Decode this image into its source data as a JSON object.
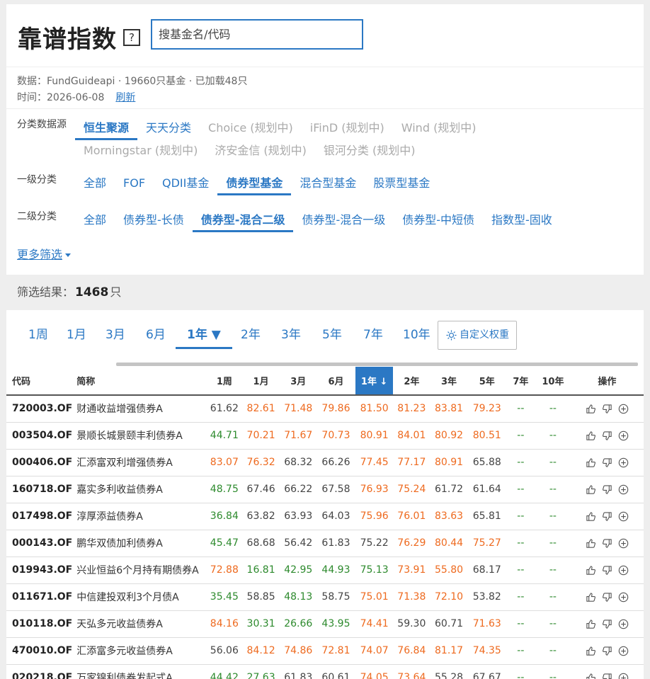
{
  "app": {
    "title": "靠谱指数",
    "help_icon": "help-icon",
    "search_placeholder": "搜基金名/代码"
  },
  "meta": {
    "line1": "数据：FundGuideapi · 19660只基金 · 已加载48只",
    "line2_label": "时间：2026-06-08",
    "refresh_label": "刷新"
  },
  "filters": {
    "source": {
      "label": "分类数据源",
      "items": [
        {
          "label": "恒生聚源",
          "state": "active"
        },
        {
          "label": "天天分类",
          "state": "normal"
        },
        {
          "label": "Choice (规划中)",
          "state": "disabled"
        },
        {
          "label": "iFinD (规划中)",
          "state": "disabled"
        },
        {
          "label": "Wind (规划中)",
          "state": "disabled"
        },
        {
          "label": "Morningstar (规划中)",
          "state": "disabled"
        },
        {
          "label": "济安金信 (规划中)",
          "state": "disabled"
        },
        {
          "label": "银河分类 (规划中)",
          "state": "disabled"
        }
      ]
    },
    "level1": {
      "label": "一级分类",
      "items": [
        {
          "label": "全部",
          "state": "normal"
        },
        {
          "label": "FOF",
          "state": "normal"
        },
        {
          "label": "QDII基金",
          "state": "normal"
        },
        {
          "label": "债券型基金",
          "state": "active"
        },
        {
          "label": "混合型基金",
          "state": "normal"
        },
        {
          "label": "股票型基金",
          "state": "normal"
        }
      ]
    },
    "level2": {
      "label": "二级分类",
      "items": [
        {
          "label": "全部",
          "state": "normal"
        },
        {
          "label": "债券型-长债",
          "state": "normal"
        },
        {
          "label": "债券型-混合二级",
          "state": "active"
        },
        {
          "label": "债券型-混合一级",
          "state": "normal"
        },
        {
          "label": "债券型-中短债",
          "state": "normal"
        },
        {
          "label": "指数型-固收",
          "state": "normal"
        }
      ]
    },
    "more_label": "更多筛选"
  },
  "results": {
    "label": "筛选结果：",
    "count": "1468",
    "unit": "只"
  },
  "periods": {
    "tabs": [
      "1周",
      "1月",
      "3月",
      "6月",
      "1年 ▼",
      "2年",
      "3年",
      "5年",
      "7年",
      "10年"
    ],
    "active_index": 4,
    "custom_weight_label": "自定义权重"
  },
  "table": {
    "headers": [
      "代码",
      "简称",
      "1周",
      "1月",
      "3月",
      "6月",
      "1年 ↓",
      "2年",
      "3年",
      "5年",
      "7年",
      "10年",
      "操作"
    ],
    "sorted_column": 6,
    "colors": {
      "green": "#2d8a2d",
      "orange": "#ee6a1f",
      "gray": "#444444",
      "accent": "#2b78c4"
    },
    "rows": [
      {
        "code": "720003.OF",
        "name": "财通收益增强债券A",
        "v": [
          "61.62",
          "82.61",
          "71.48",
          "79.86",
          "81.50",
          "81.23",
          "83.81",
          "79.23",
          "--",
          "--"
        ],
        "c": "doooooooxx"
      },
      {
        "code": "003504.OF",
        "name": "景顺长城景颐丰利债券A",
        "v": [
          "44.71",
          "70.21",
          "71.67",
          "70.73",
          "80.91",
          "84.01",
          "80.92",
          "80.51",
          "--",
          "--"
        ],
        "c": "gooooooogxx"
      },
      {
        "code": "000406.OF",
        "name": "汇添富双利增强债券A",
        "v": [
          "83.07",
          "76.32",
          "68.32",
          "66.26",
          "77.45",
          "77.17",
          "80.91",
          "65.88",
          "--",
          "--"
        ],
        "c": "ooddooodxx"
      },
      {
        "code": "160718.OF",
        "name": "嘉实多利收益债券A",
        "v": [
          "48.75",
          "67.46",
          "66.22",
          "67.58",
          "76.93",
          "75.24",
          "61.72",
          "61.64",
          "--",
          "--"
        ],
        "c": "gdddoodxdx"
      },
      {
        "code": "017498.OF",
        "name": "淳厚添益债券A",
        "v": [
          "36.84",
          "63.82",
          "63.93",
          "64.03",
          "75.96",
          "76.01",
          "83.63",
          "65.81",
          "--",
          "--"
        ],
        "c": "gdddooodxx"
      },
      {
        "code": "000143.OF",
        "name": "鹏华双债加利债券A",
        "v": [
          "45.47",
          "68.68",
          "56.42",
          "61.83",
          "75.22",
          "76.29",
          "80.44",
          "75.27",
          "--",
          "--"
        ],
        "c": "gddddoooxx"
      },
      {
        "code": "019943.OF",
        "name": "兴业恒益6个月持有期债券A",
        "v": [
          "72.88",
          "16.81",
          "42.95",
          "44.93",
          "75.13",
          "73.91",
          "55.80",
          "68.17",
          "--",
          "--"
        ],
        "c": "oggggoodxx"
      },
      {
        "code": "011671.OF",
        "name": "中信建投双利3个月债A",
        "v": [
          "35.45",
          "58.85",
          "48.13",
          "58.75",
          "75.01",
          "71.38",
          "72.10",
          "53.82",
          "--",
          "--"
        ],
        "c": "gdgdooodxx"
      },
      {
        "code": "010118.OF",
        "name": "天弘多元收益债券A",
        "v": [
          "84.16",
          "30.31",
          "26.66",
          "43.95",
          "74.41",
          "59.30",
          "60.71",
          "71.63",
          "--",
          "--"
        ],
        "c": "ogggoddoxx"
      },
      {
        "code": "470010.OF",
        "name": "汇添富多元收益债券A",
        "v": [
          "56.06",
          "84.12",
          "74.86",
          "72.81",
          "74.07",
          "76.84",
          "81.17",
          "74.35",
          "--",
          "--"
        ],
        "c": "doooooooxx"
      },
      {
        "code": "020218.OF",
        "name": "万家锦利债券发起式A",
        "v": [
          "44.42",
          "27.63",
          "61.83",
          "60.61",
          "74.05",
          "73.64",
          "55.28",
          "67.67",
          "--",
          "--"
        ],
        "c": "ggddoodddxx"
      }
    ],
    "op_icons": [
      "thumbs-up-icon",
      "thumbs-down-icon",
      "add-circle-icon"
    ]
  }
}
